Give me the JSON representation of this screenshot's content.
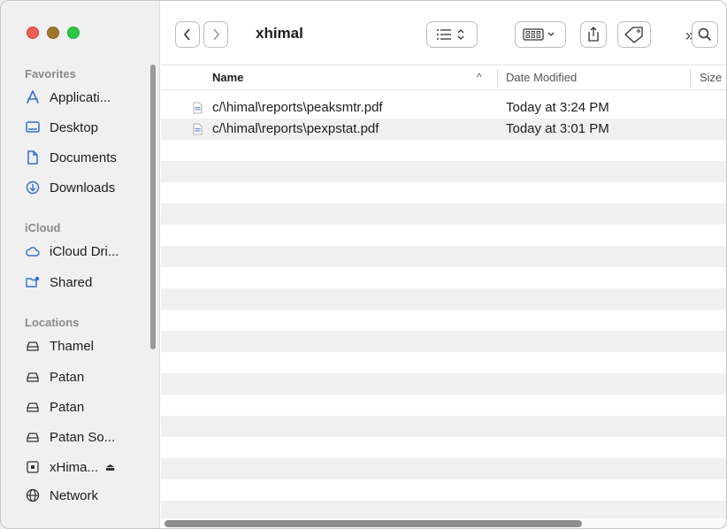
{
  "window": {
    "title": "xhimal"
  },
  "sidebar": {
    "sections": [
      {
        "label": "Favorites"
      },
      {
        "label": "iCloud"
      },
      {
        "label": "Locations"
      }
    ],
    "favorites": [
      {
        "label": "Applicati...",
        "icon": "applications-icon"
      },
      {
        "label": "Desktop",
        "icon": "desktop-icon"
      },
      {
        "label": "Documents",
        "icon": "document-icon"
      },
      {
        "label": "Downloads",
        "icon": "download-icon"
      }
    ],
    "icloud": [
      {
        "label": "iCloud Dri...",
        "icon": "cloud-icon"
      },
      {
        "label": "Shared",
        "icon": "shared-folder-icon"
      }
    ],
    "locations": [
      {
        "label": "Thamel",
        "icon": "drive-icon"
      },
      {
        "label": "Patan",
        "icon": "drive-icon"
      },
      {
        "label": "Patan",
        "icon": "drive-icon"
      },
      {
        "label": "Patan So...",
        "icon": "drive-icon"
      },
      {
        "label": "xHima...",
        "icon": "computer-icon",
        "eject": "⏏"
      },
      {
        "label": "Network",
        "icon": "network-globe-icon"
      }
    ]
  },
  "toolbar": {
    "more_label": "»"
  },
  "columns": {
    "name": "Name",
    "sort_indicator": "^",
    "date_modified": "Date Modified",
    "size": "Size"
  },
  "files": [
    {
      "name": "c/\\himal\\reports\\peaksmtr.pdf",
      "date": "Today at 3:24 PM"
    },
    {
      "name": "c/\\himal\\reports\\pexpstat.pdf",
      "date": "Today at 3:01 PM"
    }
  ],
  "colors": {
    "close": "#ec5f56",
    "minimize": "#a1762c",
    "zoom": "#28c840",
    "row_stripe": "#f0f0f0",
    "sidebar_bg": "#f1f0f0"
  }
}
